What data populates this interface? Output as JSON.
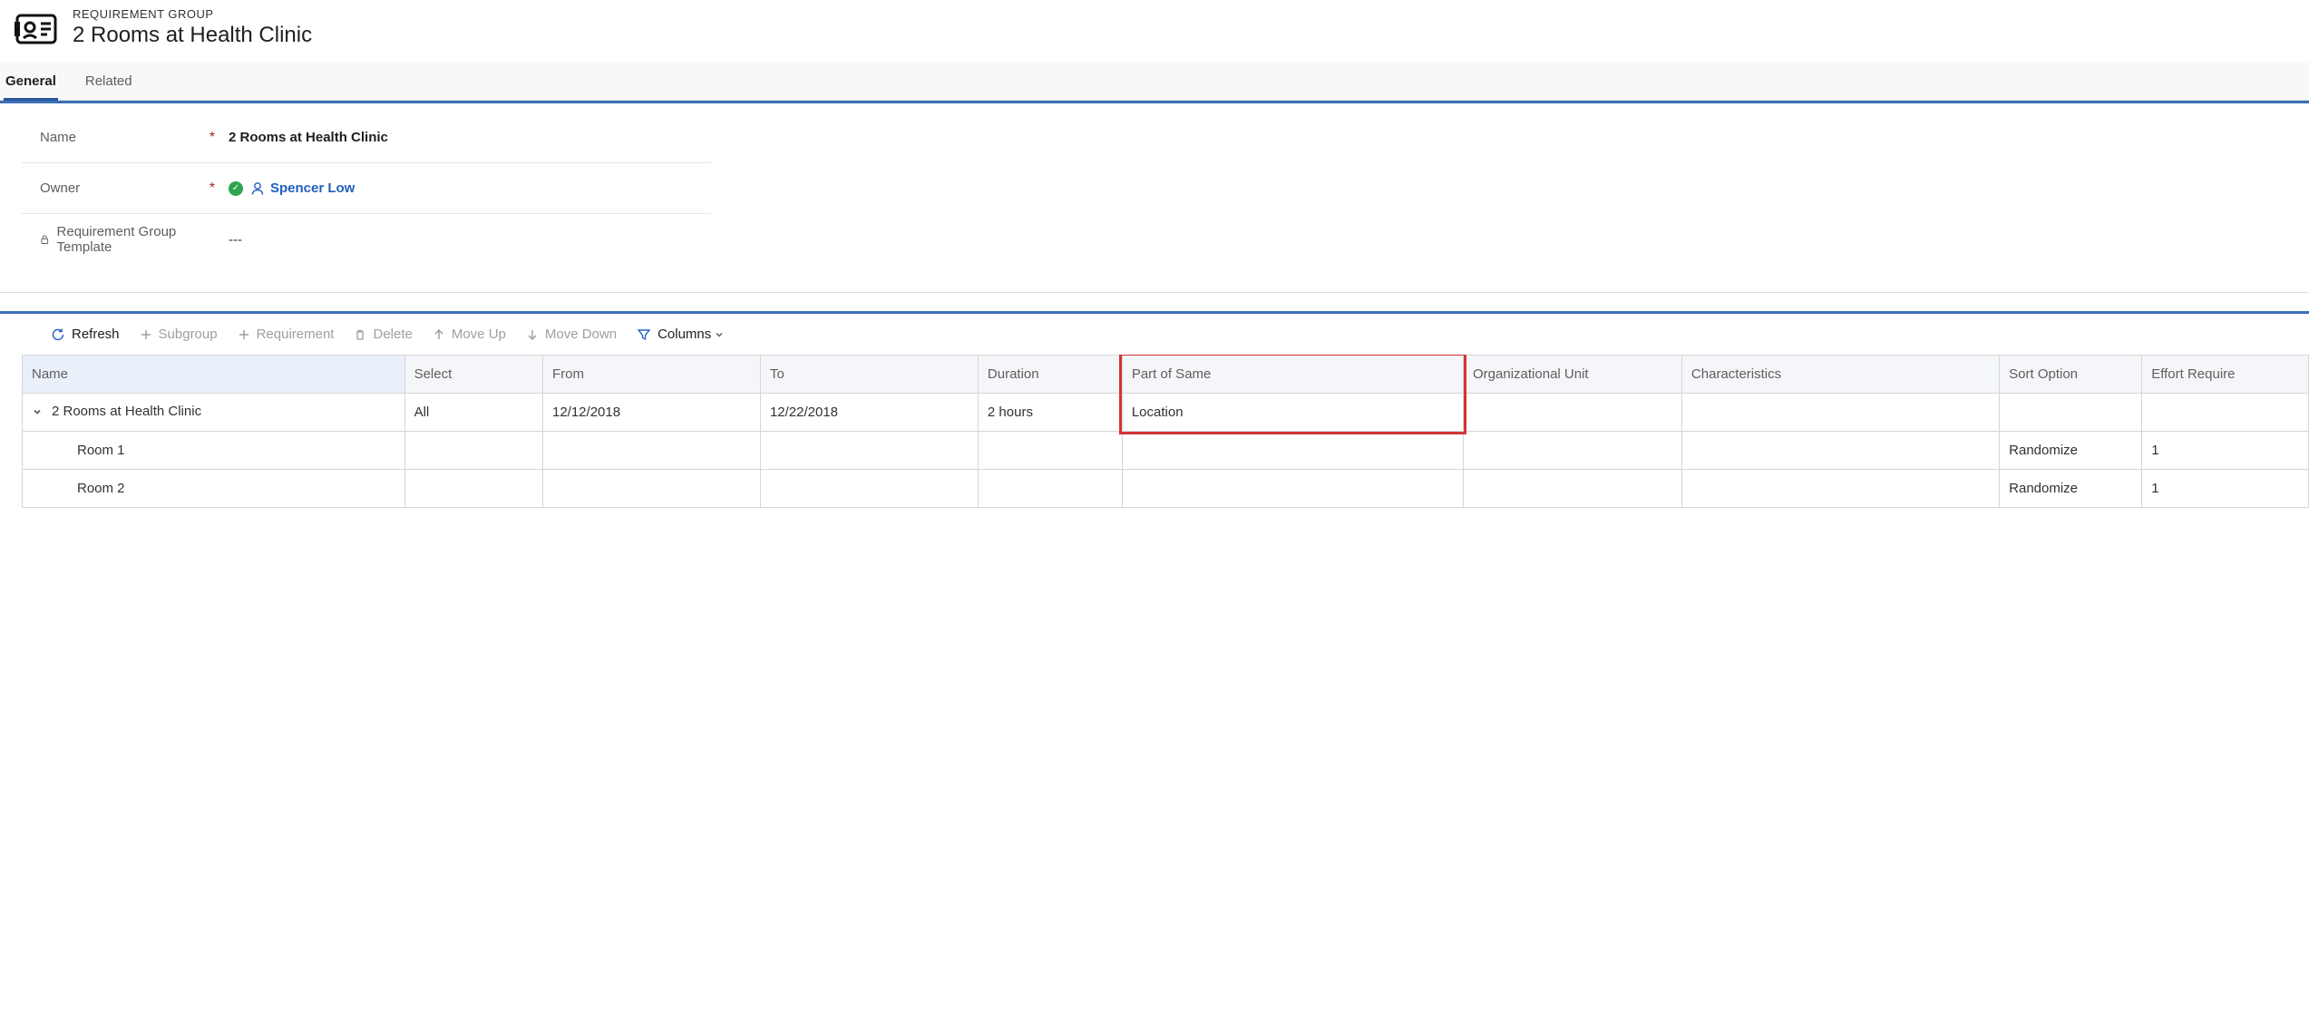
{
  "header": {
    "entity_label": "REQUIREMENT GROUP",
    "title": "2 Rooms at Health Clinic"
  },
  "tabs": {
    "general": "General",
    "related": "Related"
  },
  "form": {
    "name_label": "Name",
    "name_value": "2 Rooms at Health Clinic",
    "owner_label": "Owner",
    "owner_value": "Spencer Low",
    "template_label": "Requirement Group Template",
    "template_value": "---"
  },
  "toolbar": {
    "refresh": "Refresh",
    "subgroup": "Subgroup",
    "requirement": "Requirement",
    "delete": "Delete",
    "moveup": "Move Up",
    "movedown": "Move Down",
    "columns": "Columns"
  },
  "columns": {
    "name": "Name",
    "select": "Select",
    "from": "From",
    "to": "To",
    "duration": "Duration",
    "part_of_same": "Part of Same",
    "org_unit": "Organizational Unit",
    "characteristics": "Characteristics",
    "sort_option": "Sort Option",
    "effort_required": "Effort Require"
  },
  "rows": [
    {
      "name": "2 Rooms at Health Clinic",
      "select": "All",
      "from": "12/12/2018",
      "to": "12/22/2018",
      "duration": "2 hours",
      "part_of_same": "Location",
      "org_unit": "",
      "characteristics": "",
      "sort_option": "",
      "effort_required": "",
      "expandable": true,
      "indent": 0
    },
    {
      "name": "Room 1",
      "select": "",
      "from": "",
      "to": "",
      "duration": "",
      "part_of_same": "",
      "org_unit": "",
      "characteristics": "",
      "sort_option": "Randomize",
      "effort_required": "1",
      "expandable": false,
      "indent": 1
    },
    {
      "name": "Room 2",
      "select": "",
      "from": "",
      "to": "",
      "duration": "",
      "part_of_same": "",
      "org_unit": "",
      "characteristics": "",
      "sort_option": "Randomize",
      "effort_required": "1",
      "expandable": false,
      "indent": 1
    }
  ]
}
